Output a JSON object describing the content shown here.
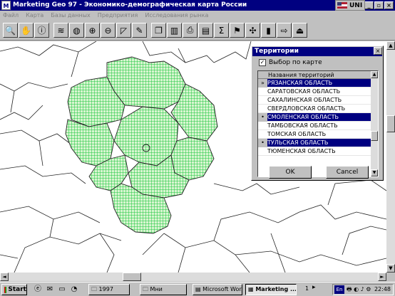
{
  "window": {
    "title": "Marketing Geo 97 - Экономико-демографическая карта России",
    "app_icon": "M",
    "lang_indicator": "UNI",
    "controls": [
      "_",
      "▫",
      "×"
    ]
  },
  "menu": [
    "Файл",
    "Карта",
    "Базы данных",
    "Предприятия",
    "Исследования рынка"
  ],
  "toolbar": {
    "icons": [
      "search-icon",
      "hand-pan-icon",
      "info-icon",
      "layers-icon",
      "globe-icon",
      "zoom-in-icon",
      "zoom-out-icon",
      "select-icon",
      "edit-icon",
      "copy-icon",
      "chart-icon",
      "print-icon",
      "data-icon",
      "sigma-icon",
      "flag-icon",
      "network-icon",
      "bars-icon",
      "export-icon",
      "exit-icon"
    ],
    "glyphs": [
      "🔍",
      "✋",
      "ⓘ",
      "≋",
      "◍",
      "⊕",
      "⊖",
      "◸",
      "✎",
      "❐",
      "▥",
      "⎙",
      "▤",
      "Σ",
      "⚑",
      "✣",
      "▮",
      "⇨",
      "⏏"
    ]
  },
  "dialog": {
    "title": "Территории",
    "close": "×",
    "checkbox_label": "Выбор по карте",
    "checkbox_checked": true,
    "list_header": "Названия территорий",
    "rows": [
      {
        "name": "РЯЗАНСКАЯ ОБЛАСТЬ",
        "selected": true,
        "marker": "»"
      },
      {
        "name": "САРАТОВСКАЯ ОБЛАСТЬ",
        "selected": false,
        "marker": ""
      },
      {
        "name": "САХАЛИНСКАЯ ОБЛАСТЬ",
        "selected": false,
        "marker": ""
      },
      {
        "name": "СВЕРДЛОВСКАЯ ОБЛАСТЬ",
        "selected": false,
        "marker": ""
      },
      {
        "name": "СМОЛЕНСКАЯ ОБЛАСТЬ",
        "selected": true,
        "marker": "•"
      },
      {
        "name": "ТАМБОВСКАЯ ОБЛАСТЬ",
        "selected": false,
        "marker": ""
      },
      {
        "name": "ТОМСКАЯ ОБЛАСТЬ",
        "selected": false,
        "marker": ""
      },
      {
        "name": "ТУЛЬСКАЯ ОБЛАСТЬ",
        "selected": true,
        "marker": "•"
      },
      {
        "name": "ТЮМЕНСКАЯ ОБЛАСТЬ",
        "selected": false,
        "marker": ""
      }
    ],
    "ok_label": "OK",
    "cancel_label": "Cancel"
  },
  "colors": {
    "title_bar": "#000080",
    "selection": "#000080",
    "map_fill": "#d8f5d0",
    "map_hatch": "#19c63c"
  },
  "taskbar": {
    "start_label": "Start",
    "tasks": [
      {
        "label": "1997",
        "active": false
      },
      {
        "label": "Мни",
        "active": false
      },
      {
        "label": "Microsoft Wor...",
        "active": false
      },
      {
        "label": "Marketing ...",
        "active": true
      }
    ],
    "tray_lang": "En",
    "page_indicator": "1",
    "clock": "22:48"
  }
}
